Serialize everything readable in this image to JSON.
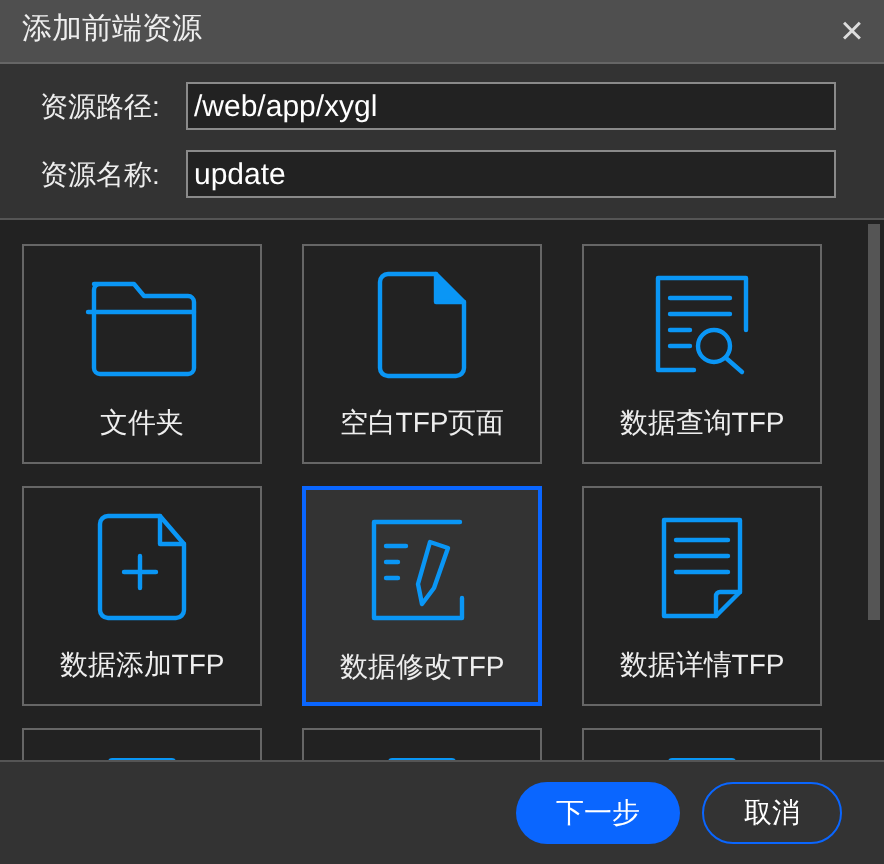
{
  "window": {
    "title": "添加前端资源",
    "close": "×"
  },
  "form": [
    {
      "label": "资源路径:",
      "value": "/web/app/xygl"
    },
    {
      "label": "资源名称:",
      "value": "update"
    }
  ],
  "templates": [
    {
      "kind": "folder",
      "label": "文件夹",
      "selected": false
    },
    {
      "kind": "blank",
      "label": "空白TFP页面",
      "selected": false
    },
    {
      "kind": "query",
      "label": "数据查询TFP",
      "selected": false
    },
    {
      "kind": "add",
      "label": "数据添加TFP",
      "selected": false
    },
    {
      "kind": "edit",
      "label": "数据修改TFP",
      "selected": true
    },
    {
      "kind": "detail",
      "label": "数据详情TFP",
      "selected": false
    },
    {
      "kind": "partial",
      "selected": false
    },
    {
      "kind": "partial",
      "selected": false
    },
    {
      "kind": "partial",
      "selected": false
    }
  ],
  "buttons": [
    {
      "kind": "primary",
      "label": "下一步"
    },
    {
      "kind": "secondary",
      "label": "取消"
    }
  ]
}
